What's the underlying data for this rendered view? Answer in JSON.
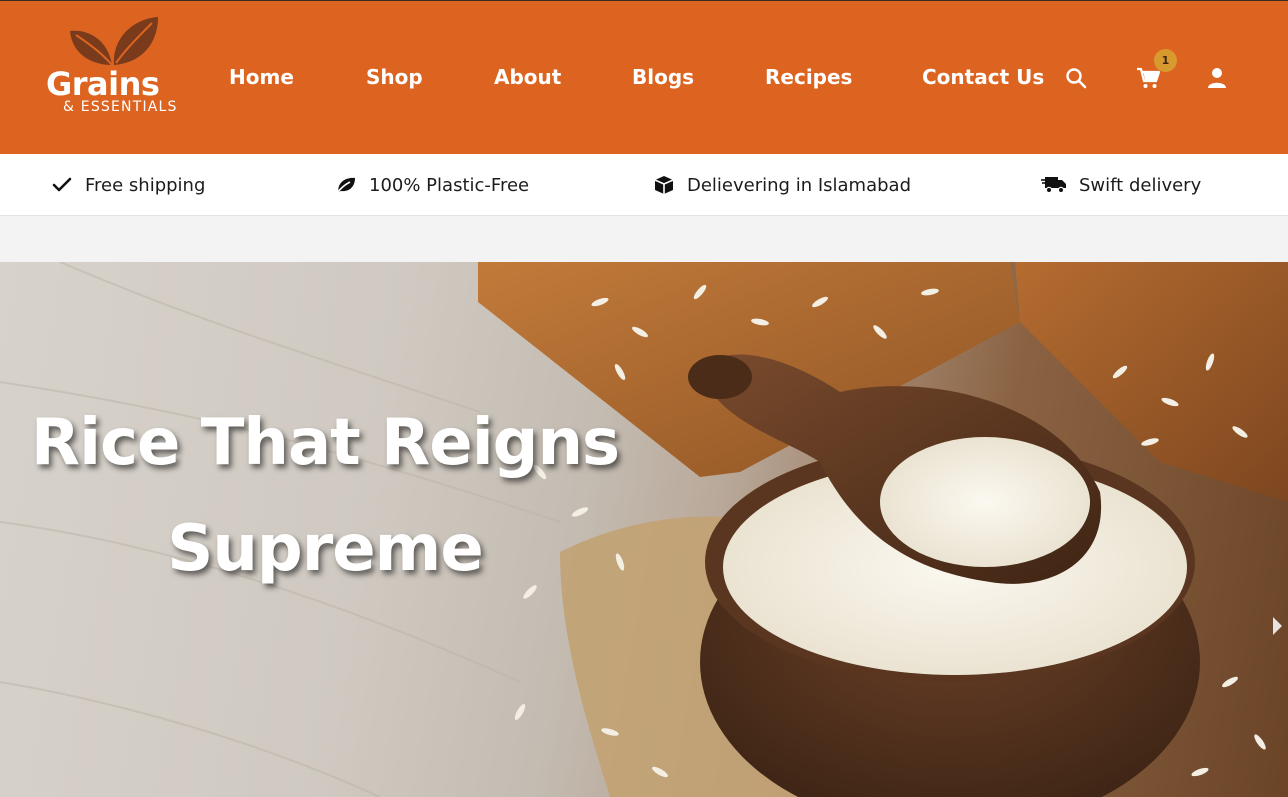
{
  "brand": {
    "name": "Grains",
    "tagline": "& ESSENTIALS",
    "logo_icon": "leaves-icon",
    "header_color": "#dc6420",
    "logo_leaf_color": "#7a3a1c"
  },
  "nav": {
    "items": [
      {
        "label": "Home"
      },
      {
        "label": "Shop"
      },
      {
        "label": "About"
      },
      {
        "label": "Blogs"
      },
      {
        "label": "Recipes"
      },
      {
        "label": "Contact Us"
      }
    ],
    "icons": {
      "search": "search-icon",
      "cart": "cart-icon",
      "account": "user-icon"
    },
    "cart_count": "1",
    "cart_badge_color": "#d89a2e"
  },
  "features": [
    {
      "label": "Free shipping",
      "icon": "check-icon"
    },
    {
      "label": "100% Plastic-Free",
      "icon": "leaf-icon"
    },
    {
      "label": "Delievering in Islamabad",
      "icon": "box-icon"
    },
    {
      "label": "Swift delivery",
      "icon": "truck-icon"
    }
  ],
  "hero": {
    "title": "Rice That Reigns Supreme",
    "next_icon": "chevron-right-icon"
  }
}
